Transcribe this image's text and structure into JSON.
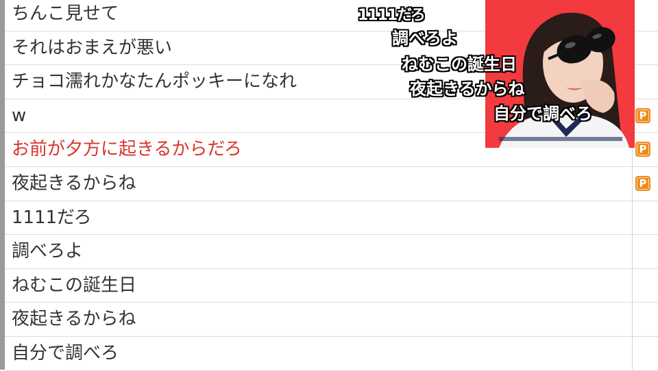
{
  "comments": [
    {
      "text": "ちんこ見せて",
      "highlight": false,
      "premium": false
    },
    {
      "text": "それはおまえが悪い",
      "highlight": false,
      "premium": false
    },
    {
      "text": "チョコ濡れかなたんポッキーになれ",
      "highlight": false,
      "premium": false
    },
    {
      "text": "w",
      "highlight": false,
      "premium": true
    },
    {
      "text": "お前が夕方に起きるからだろ",
      "highlight": true,
      "premium": true
    },
    {
      "text": "夜起きるからね",
      "highlight": false,
      "premium": true
    },
    {
      "text": "1111だろ",
      "highlight": false,
      "premium": false
    },
    {
      "text": "調べろよ",
      "highlight": false,
      "premium": false
    },
    {
      "text": "ねむこの誕生日",
      "highlight": false,
      "premium": false
    },
    {
      "text": "夜起きるからね",
      "highlight": false,
      "premium": false
    },
    {
      "text": "自分で調べろ",
      "highlight": false,
      "premium": false
    }
  ],
  "premium_badge": "P",
  "overlay_comments": [
    "1111だろ",
    "調べろよ",
    "ねむこの誕生日",
    "夜起きるからね",
    "自分で調べろ"
  ],
  "colors": {
    "highlight_text": "#d9342b",
    "badge": "#ef8a1c",
    "thumbnail_bg": "#f23a3f"
  }
}
